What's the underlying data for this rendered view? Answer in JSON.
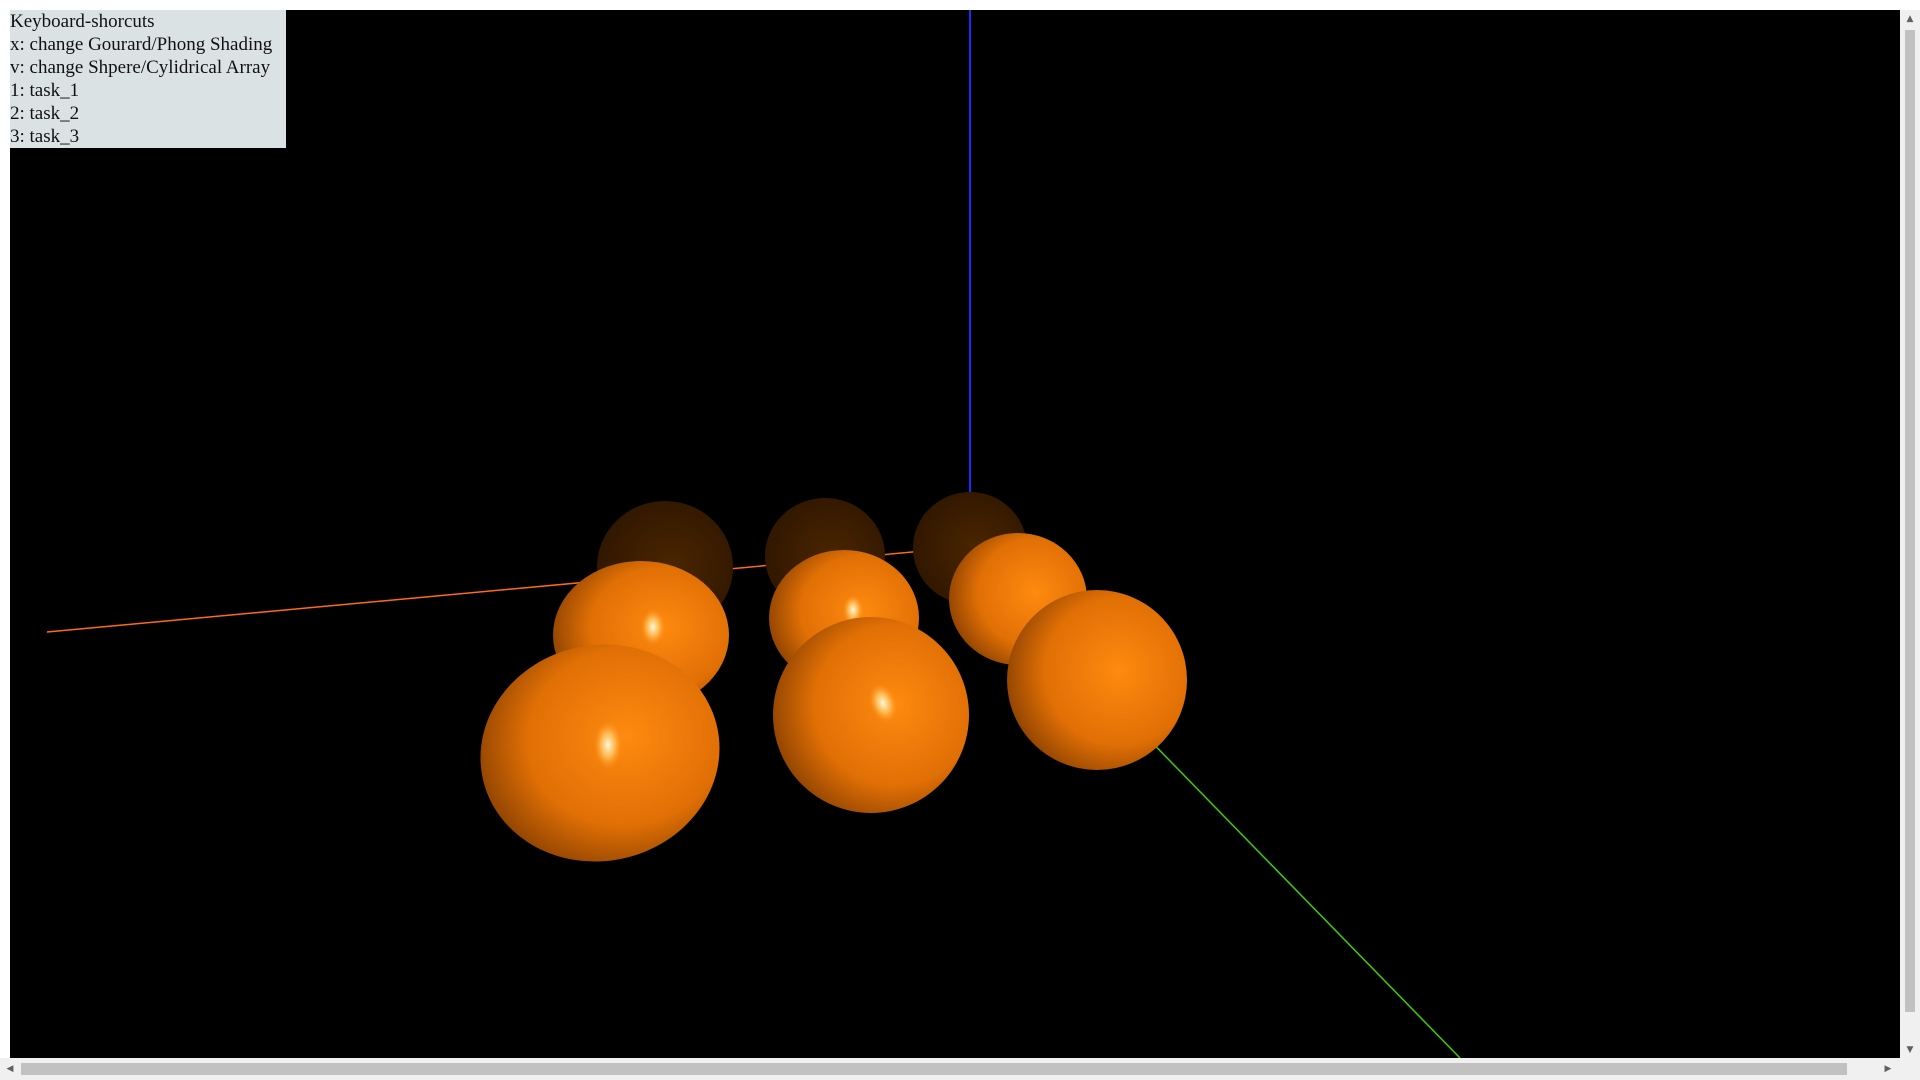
{
  "help": {
    "title": "Keyboard-shorcuts",
    "lines": [
      "x: change Gourard/Phong Shading",
      "v: change Shpere/Cylidrical Array",
      "1: task_1",
      "2: task_2",
      "3: task_3"
    ]
  },
  "scene": {
    "background": "#000000",
    "sphere_color": "#ff7f00",
    "axis_colors": {
      "x": "#ff6a1a",
      "y": "#3fcf00",
      "z": "#1a2cff"
    }
  },
  "scrollbars": {
    "up_arrow": "▲",
    "down_arrow": "▼",
    "left_arrow": "◀",
    "right_arrow": "▶"
  }
}
